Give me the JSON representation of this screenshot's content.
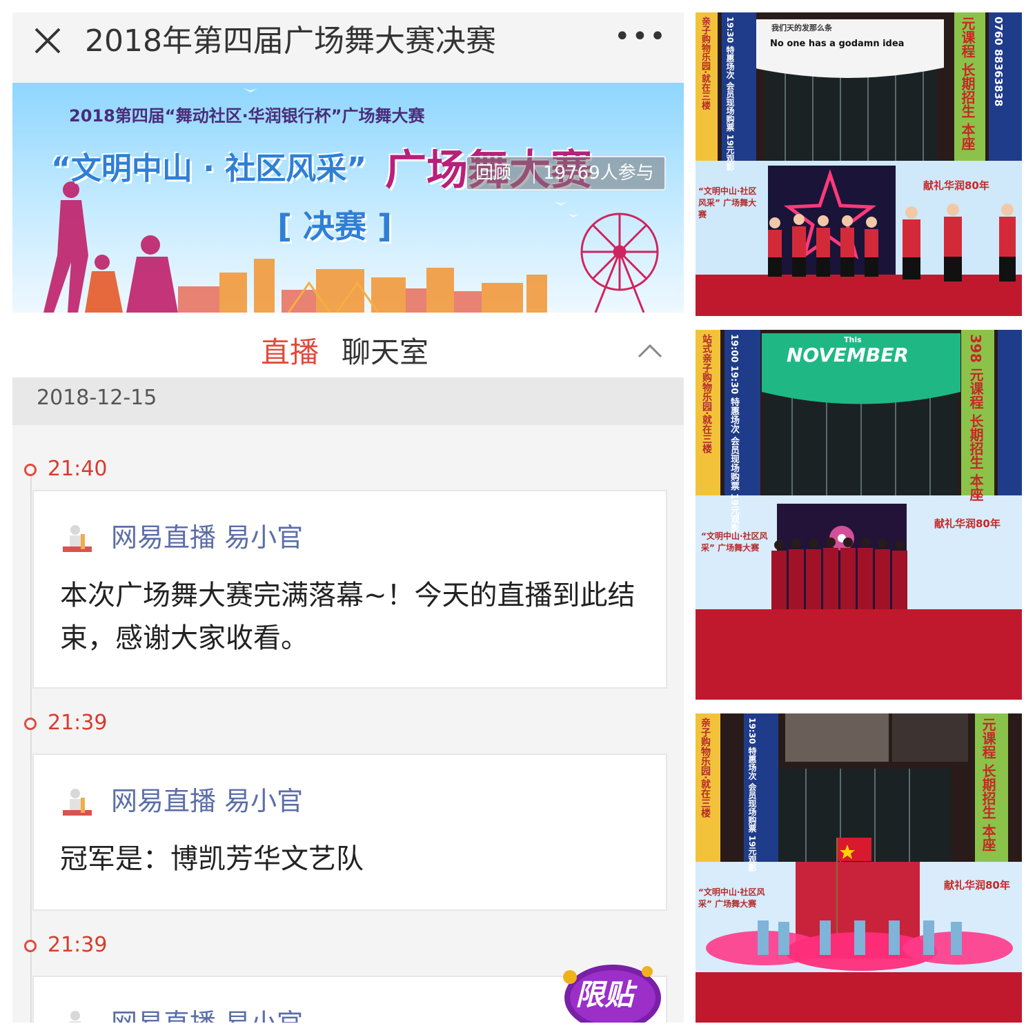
{
  "header": {
    "title": "2018年第四届广场舞大赛决赛",
    "more": "•••"
  },
  "banner": {
    "subtitle": "2018第四届“舞动社区·华润银行杯”广场舞大赛",
    "title_part1": "“文明中山 · 社区风采”",
    "title_part2": "广场舞大赛",
    "stage": "[ 决赛 ]",
    "replay_label": "回顾",
    "participants": "19769人参与"
  },
  "tabs": {
    "live": "直播",
    "chat": "聊天室"
  },
  "date": "2018-12-15",
  "entries": [
    {
      "time": "21:40",
      "author": "网易直播 易小官",
      "message": "本次广场舞大赛完满落幕~！今天的直播到此结束，感谢大家收看。"
    },
    {
      "time": "21:39",
      "author": "网易直播 易小官",
      "message": "冠军是：博凯芳华文艺队"
    },
    {
      "time": "21:39",
      "author": "网易直播 易小官",
      "message": ""
    }
  ],
  "ad_badge": "限贴",
  "photos": [
    {
      "screen_text_1": "我们天的发那么条",
      "screen_text_2": "No one has a godamn idea",
      "left_banner": "亲子购物乐园·就在三楼",
      "blue_banner": "19:30 特惠场次 会员现场购票 19元观影",
      "right_banner": "元课程 长期招生 本座",
      "phone": "0760 88363838",
      "backdrop_left": "“文明中山·社区风采” 广场舞大赛",
      "backdrop_right": "献礼华润80年"
    },
    {
      "screen_text_1": "This",
      "screen_text_2": "NOVEMBER",
      "left_banner": "站式亲子购物乐园·就在三楼",
      "blue_banner": "19:00 19:30 特惠场次 会员现场购票 19元观影",
      "right_banner": "398 元课程 长期招生 本座",
      "backdrop_left": "“文明中山·社区风采” 广场舞大赛",
      "backdrop_right": "献礼华润80年"
    },
    {
      "left_banner": "亲子购物乐园·就在三楼",
      "blue_banner": "19:30 特惠场次 会员现场购票 19元观影",
      "right_banner": "元课程 长期招生 本座",
      "backdrop_left": "“文明中山·社区风采” 广场舞大赛",
      "backdrop_right": "献礼华润80年"
    }
  ],
  "colors": {
    "accent_red": "#e04b3b",
    "author_blue": "#5b6ea8",
    "stage_red": "#c0192e"
  }
}
